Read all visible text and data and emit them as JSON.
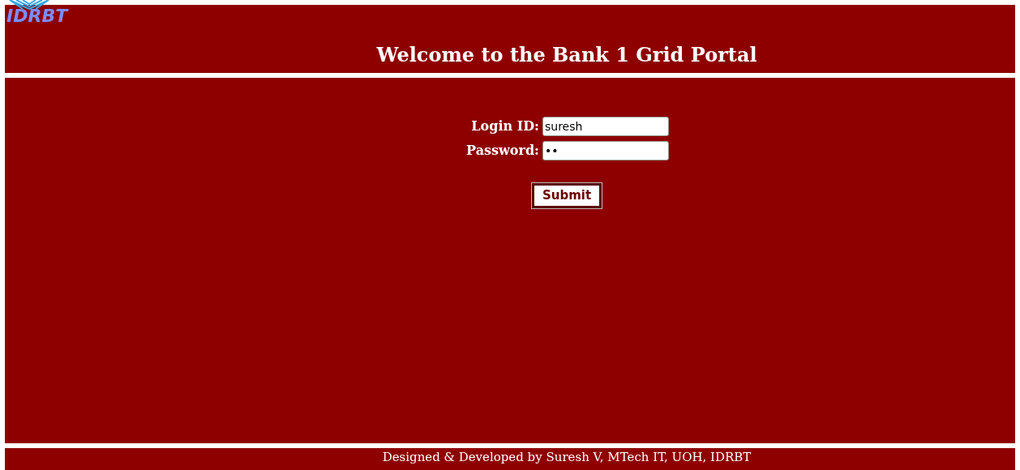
{
  "header": {
    "logo_text": "IDRBT",
    "title": "Welcome to the Bank 1 Grid Portal"
  },
  "login_form": {
    "fields": [
      {
        "label": "Login ID:",
        "value": "suresh"
      },
      {
        "label": "Password:",
        "value": "••"
      }
    ],
    "submit": "Submit"
  },
  "footer": "Designed & Developed by Suresh V, MTech IT, UOH, IDRBT"
}
